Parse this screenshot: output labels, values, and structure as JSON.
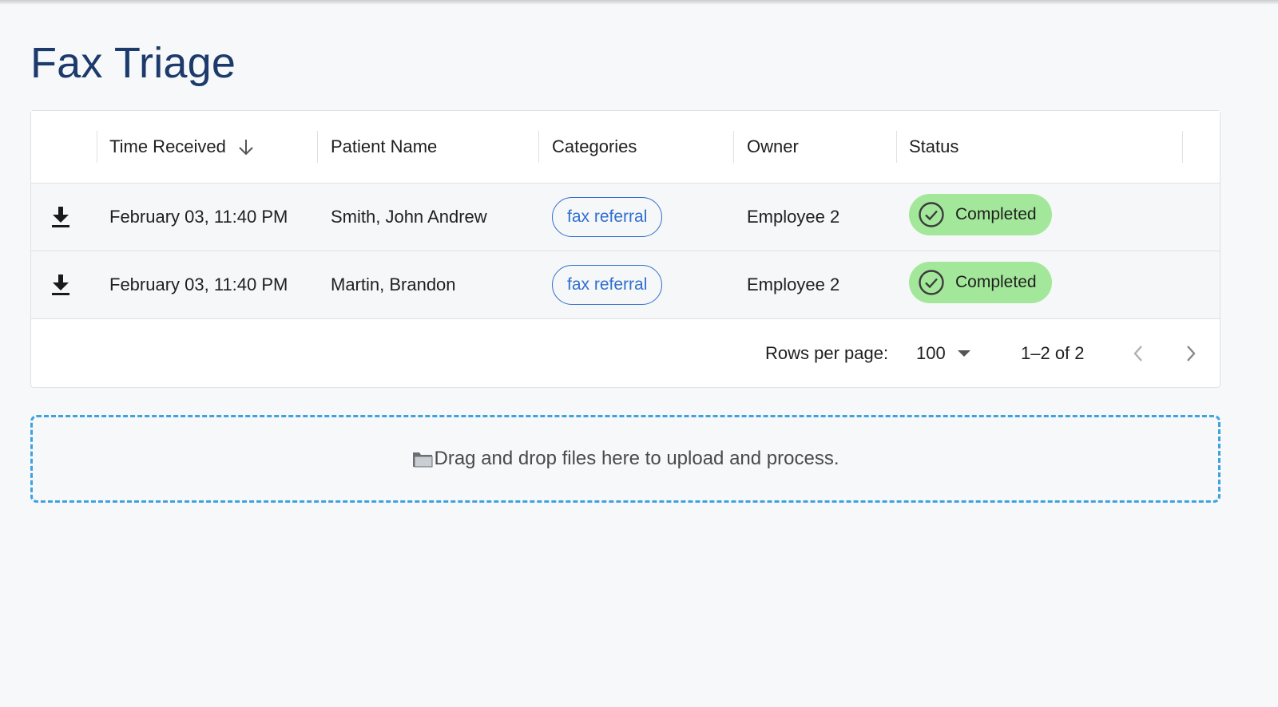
{
  "page": {
    "title": "Fax Triage"
  },
  "colors": {
    "title": "#1c3a6b",
    "chip_border": "#2f6fcf",
    "status_completed_bg": "#a3e89a",
    "dropzone_border": "#3fa2e0"
  },
  "table": {
    "columns": [
      {
        "key": "download",
        "label": ""
      },
      {
        "key": "time_received",
        "label": "Time Received",
        "sort": "descending"
      },
      {
        "key": "patient_name",
        "label": "Patient Name"
      },
      {
        "key": "categories",
        "label": "Categories"
      },
      {
        "key": "owner",
        "label": "Owner"
      },
      {
        "key": "status",
        "label": "Status"
      }
    ],
    "rows": [
      {
        "download_icon": "download-icon",
        "time_received": "February 03, 11:40 PM",
        "patient_name": "Smith, John Andrew",
        "category": "fax referral",
        "owner": "Employee 2",
        "status": "Completed",
        "status_icon": "check-circle-icon"
      },
      {
        "download_icon": "download-icon",
        "time_received": "February 03, 11:40 PM",
        "patient_name": "Martin, Brandon",
        "category": "fax referral",
        "owner": "Employee 2",
        "status": "Completed",
        "status_icon": "check-circle-icon"
      }
    ],
    "pagination": {
      "rows_per_page_label": "Rows per page:",
      "rows_per_page_value": "100",
      "range_text": "1–2 of 2",
      "prev_icon": "chevron-left-icon",
      "next_icon": "chevron-right-icon"
    }
  },
  "dropzone": {
    "icon": "folder-icon",
    "text": "Drag and drop files here to upload and process."
  }
}
